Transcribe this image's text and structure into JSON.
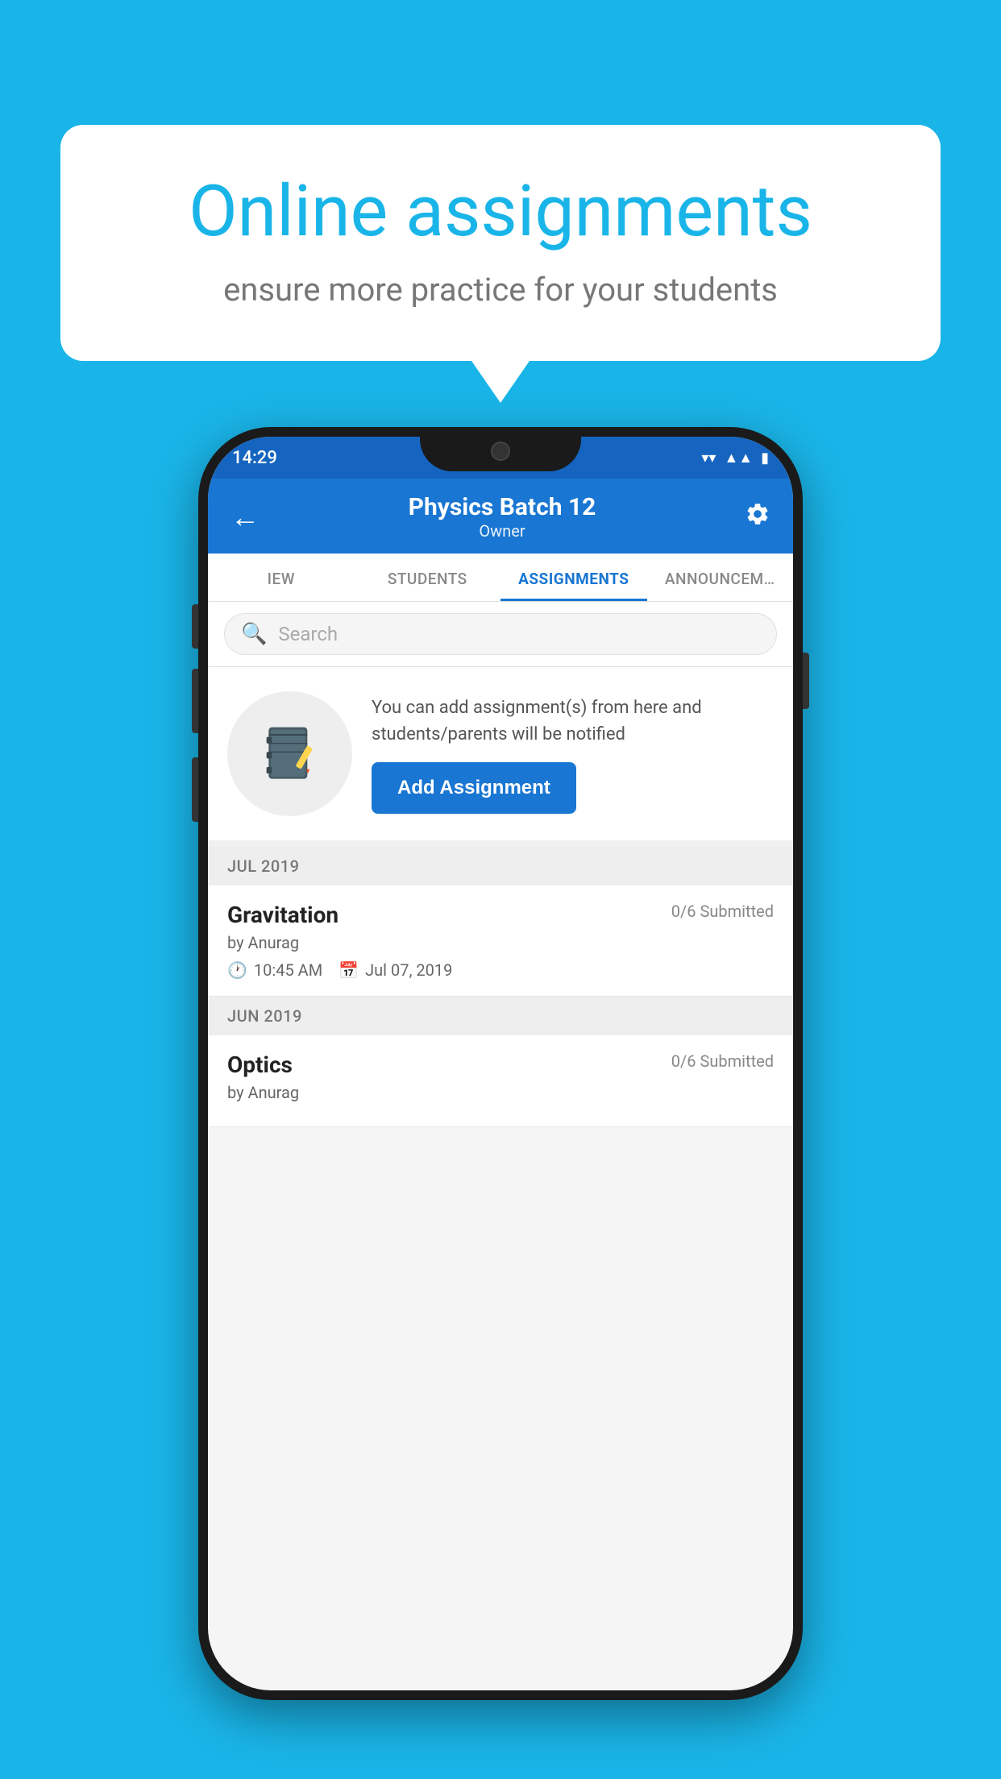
{
  "background": {
    "color": "#1ab5e8"
  },
  "speech_bubble": {
    "title": "Online assignments",
    "subtitle": "ensure more practice for your students"
  },
  "phone": {
    "status_bar": {
      "time": "14:29",
      "wifi_icon": "wifi",
      "signal_icon": "signal",
      "battery_icon": "battery"
    },
    "header": {
      "title": "Physics Batch 12",
      "subtitle": "Owner",
      "back_label": "←",
      "settings_icon": "gear"
    },
    "tabs": [
      {
        "label": "IEW",
        "active": false
      },
      {
        "label": "STUDENTS",
        "active": false
      },
      {
        "label": "ASSIGNMENTS",
        "active": true
      },
      {
        "label": "ANNOUNCEM…",
        "active": false
      }
    ],
    "search": {
      "placeholder": "Search"
    },
    "promo_block": {
      "description": "You can add assignment(s) from here and students/parents will be notified",
      "button_label": "Add Assignment"
    },
    "assignments": [
      {
        "month": "JUL 2019",
        "items": [
          {
            "name": "Gravitation",
            "submitted": "0/6 Submitted",
            "by": "by Anurag",
            "time": "10:45 AM",
            "date": "Jul 07, 2019"
          }
        ]
      },
      {
        "month": "JUN 2019",
        "items": [
          {
            "name": "Optics",
            "submitted": "0/6 Submitted",
            "by": "by Anurag",
            "time": "",
            "date": ""
          }
        ]
      }
    ]
  }
}
